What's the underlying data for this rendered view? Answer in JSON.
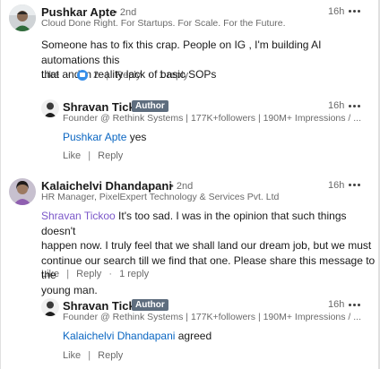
{
  "comments": [
    {
      "name": "Pushkar Apte",
      "degree": "• 2nd",
      "headline": "Cloud Done Right. For Startups. For Scale. For the Future.",
      "time": "16h",
      "text_lines": [
        "Someone has to fix this crap. People on IG , I'm building AI automations this",
        "that and in reality lack of basic SOPs"
      ],
      "like_label": "Like",
      "like_count": "2",
      "reply_label": "Reply",
      "replies_label": "1 reply"
    },
    {
      "name": "Kalaichelvi Dhandapani",
      "degree": "• 2nd",
      "headline": "HR Manager, PixelExpert Technology & Services Pvt. Ltd",
      "time": "16h",
      "mention": "Shravan Tickoo",
      "text_first": " It's too sad. I was in the opinion that such things doesn't",
      "text_lines": [
        "happen now. I truly feel that we shall land our dream job, but we must",
        "continue our search till we find that one. Please share this message to the",
        "young man."
      ],
      "like_label": "Like",
      "reply_label": "Reply",
      "replies_label": "1 reply"
    }
  ],
  "replies": [
    {
      "name": "Shravan Tickoo",
      "badge": "Author",
      "headline": "Founder @ Rethink Systems | 177K+followers | 190M+ Impressions / ...",
      "time": "16h",
      "mention": "Pushkar Apte",
      "text": " yes",
      "like_label": "Like",
      "reply_label": "Reply"
    },
    {
      "name": "Shravan Tickoo",
      "badge": "Author",
      "headline": "Founder @ Rethink Systems | 177K+followers | 190M+ Impressions / ...",
      "time": "16h",
      "mention": "Kalaichelvi Dhandapani",
      "text": " agreed",
      "like_label": "Like",
      "reply_label": "Reply"
    }
  ],
  "colors": {
    "mention_blue": "#0a66c2",
    "mention_purple": "#7b57c9",
    "author_badge": "#5e6d7e"
  },
  "icons": [
    "more-options-icon",
    "like-reaction-icon"
  ]
}
